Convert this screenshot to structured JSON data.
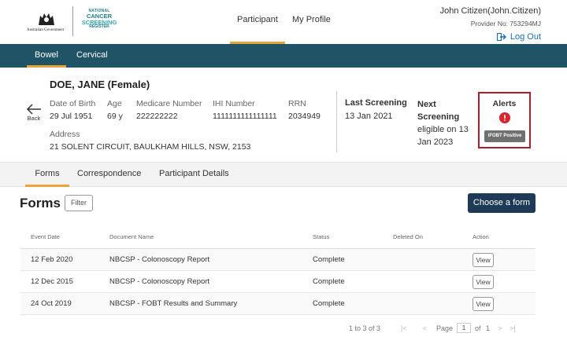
{
  "header": {
    "gov_name": "Australian Government",
    "ncsr_logo": [
      "NATIONAL",
      "CANCER",
      "SCREENING",
      "REGISTER"
    ],
    "nav": [
      "Participant",
      "My Profile"
    ],
    "user_name": "John Citizen(John.Citizen)",
    "provider_no": "Provider No: 753294MJ",
    "logout_label": "Log Out"
  },
  "programs": [
    "Bowel",
    "Cervical"
  ],
  "patient": {
    "name": "DOE, JANE (Female)",
    "back_label": "Back",
    "fields": {
      "dob": {
        "label": "Date of Birth",
        "value": "29 Jul 1951"
      },
      "age": {
        "label": "Age",
        "value": "69 y"
      },
      "medicare": {
        "label": "Medicare Number",
        "value": "222222222"
      },
      "ihi": {
        "label": "IHI Number",
        "value": "1111111111111111"
      },
      "rrn": {
        "label": "RRN",
        "value": "2034949"
      },
      "address": {
        "label": "Address",
        "value": "21 SOLENT CIRCUIT, BAULKHAM HILLS, NSW, 2153"
      }
    },
    "last_screening": {
      "label": "Last Screening",
      "value": "13 Jan 2021"
    },
    "next_screening": {
      "label": "Next Screening",
      "value": "eligible on 13 Jan 2023"
    },
    "alerts": {
      "title": "Alerts",
      "badge": "iFOBT Positive"
    }
  },
  "subtabs": [
    "Forms",
    "Correspondence",
    "Participant Details"
  ],
  "forms": {
    "title": "Forms",
    "filter_label": "Filter",
    "choose_label": "Choose a form",
    "columns": [
      "Event Date",
      "Document Name",
      "Status",
      "Deleted On",
      "Action"
    ],
    "rows": [
      {
        "date": "12 Feb 2020",
        "doc": "NBCSP - Colonoscopy Report",
        "status": "Complete",
        "deleted": "",
        "action": "View"
      },
      {
        "date": "12 Dec 2015",
        "doc": "NBCSP - Colonoscopy Report",
        "status": "Complete",
        "deleted": "",
        "action": "View"
      },
      {
        "date": "24 Oct 2019",
        "doc": "NBCSP - FOBT Results and Summary",
        "status": "Complete",
        "deleted": "",
        "action": "View"
      }
    ]
  },
  "pager": {
    "range": "1 to 3 of 3",
    "page_label": "Page",
    "page": "1",
    "of_label": "of",
    "total": "1"
  }
}
